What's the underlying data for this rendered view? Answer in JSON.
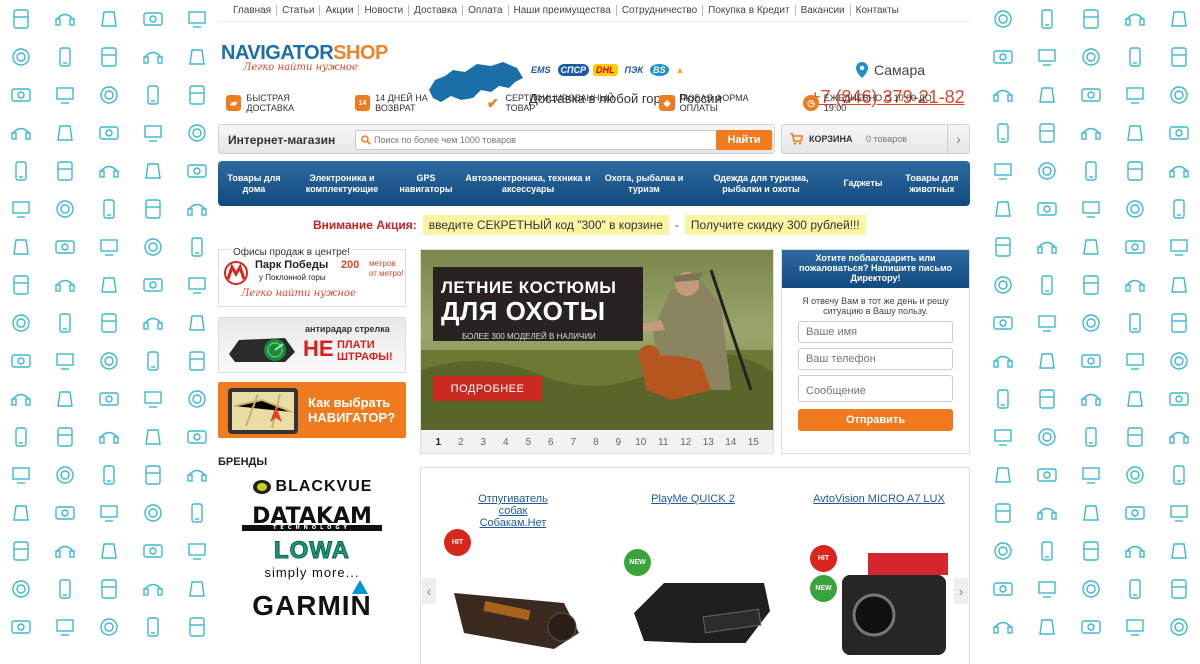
{
  "topnav": [
    "Главная",
    "Статьи",
    "Акции",
    "Новости",
    "Доставка",
    "Оплата",
    "Наши преимущества",
    "Сотрудничество",
    "Покупка в Кредит",
    "Вакансии",
    "Контакты"
  ],
  "logo": {
    "part1": "NAVIGATOR",
    "part2": "SHOP",
    "tagline": "Легко найти нужное"
  },
  "header": {
    "delivery": "Доставка в любой город России",
    "carriers": [
      "EMS",
      "СПСР",
      "DHL",
      "ПЭК",
      "BS",
      "▲"
    ],
    "city": "Самара",
    "phone": "+7 (846) 379-21-82"
  },
  "features": [
    {
      "icon": "truck-icon",
      "label": "БЫСТРАЯ ДОСТАВКА",
      "color": "#f07b1f",
      "glyph": "▰"
    },
    {
      "icon": "calendar-icon",
      "label": "14 ДНЕЙ НА ВОЗВРАТ",
      "color": "#f07b1f",
      "glyph": "14"
    },
    {
      "icon": "checkmark-icon",
      "label": "СЕРТИФИЦИРОВАННЫЙ ТОВАР",
      "color": "#f07b1f",
      "glyph": "✔"
    },
    {
      "icon": "tag-icon",
      "label": "ЛЮБАЯ ФОРМА ОПЛАТЫ",
      "color": "#f07b1f",
      "glyph": "◆"
    },
    {
      "icon": "clock-icon",
      "label": "ЕЖЕДНЕВНО С 10:00 ДО 19:00",
      "color": "#f07b1f",
      "glyph": "◷"
    }
  ],
  "search": {
    "label": "Интернет-магазин",
    "placeholder": "Поиск по более чем 1000 товаров",
    "button": "Найти"
  },
  "cart": {
    "label": "КОРЗИНА",
    "count": "0 товаров"
  },
  "catalog": [
    {
      "label": "Товары для дома",
      "w": 72
    },
    {
      "label": "Электроника и комплектующие",
      "w": 104
    },
    {
      "label": "GPS навигаторы",
      "w": 64
    },
    {
      "label": "Автоэлектроника, техника и аксессуары",
      "w": 140
    },
    {
      "label": "Охота, рыбалка и туризм",
      "w": 92
    },
    {
      "label": "Одежда для туризма, рыбалки и охоты",
      "w": 142
    },
    {
      "label": "Гаджеты",
      "w": 62
    },
    {
      "label": "Товары для животных",
      "w": 76
    }
  ],
  "promo": {
    "label": "Внимание Акция:",
    "part1": "введите СЕКРЕТНЫЙ код \"300\" в корзине",
    "dash": "-",
    "part2": "Получите скидку 300 рублей!!!"
  },
  "office": {
    "title": "Офисы продаж в центре!",
    "name": "Парк Победы",
    "sub": "у Поклонной горы",
    "distance": "200",
    "unit": "метров от метро!",
    "slogan": "Легко найти нужное"
  },
  "radar_banner": {
    "label": "антирадар стрелка",
    "big": "НЕ",
    "small": "ПЛАТИ ШТРАФЫ!"
  },
  "nav_banner": {
    "text": "Как выбрать НАВИГАТОР?"
  },
  "brands": {
    "title": "БРЕНДЫ",
    "items": [
      "BLACKVUE",
      "DATAKAM",
      "TECHNOLOGY",
      "LOWA",
      "simply more...",
      "GARMIN"
    ]
  },
  "slider": {
    "title1": "ЛЕТНИЕ КОСТЮМЫ",
    "title2": "ДЛЯ ОХОТЫ",
    "sub": "БОЛЕЕ 300 МОДЕЛЕЙ В НАЛИЧИИ",
    "button": "ПОДРОБНЕЕ",
    "pages": [
      "1",
      "2",
      "3",
      "4",
      "5",
      "6",
      "7",
      "8",
      "9",
      "10",
      "11",
      "12",
      "13",
      "14",
      "15"
    ],
    "active_page": "1"
  },
  "feedback": {
    "title": "Хотите поблагодарить или пожаловаться? Напишите письмо Директору!",
    "note": "Я отвечу Вам в тот же день и решу ситуацию в Вашу пользу.",
    "name_ph": "Ваше имя",
    "phone_ph": "Ваш телефон",
    "message_ph": "Сообщение",
    "send": "Отправить"
  },
  "products": [
    {
      "name": "Отпугиватель собак Собакам.Нет",
      "badges": [
        "HIT"
      ]
    },
    {
      "name": "PlayMe QUICK 2",
      "badges": [
        "NEW"
      ]
    },
    {
      "name": "AvtoVision MICRO A7 LUX",
      "badges": [
        "HIT",
        "NEW"
      ]
    }
  ]
}
